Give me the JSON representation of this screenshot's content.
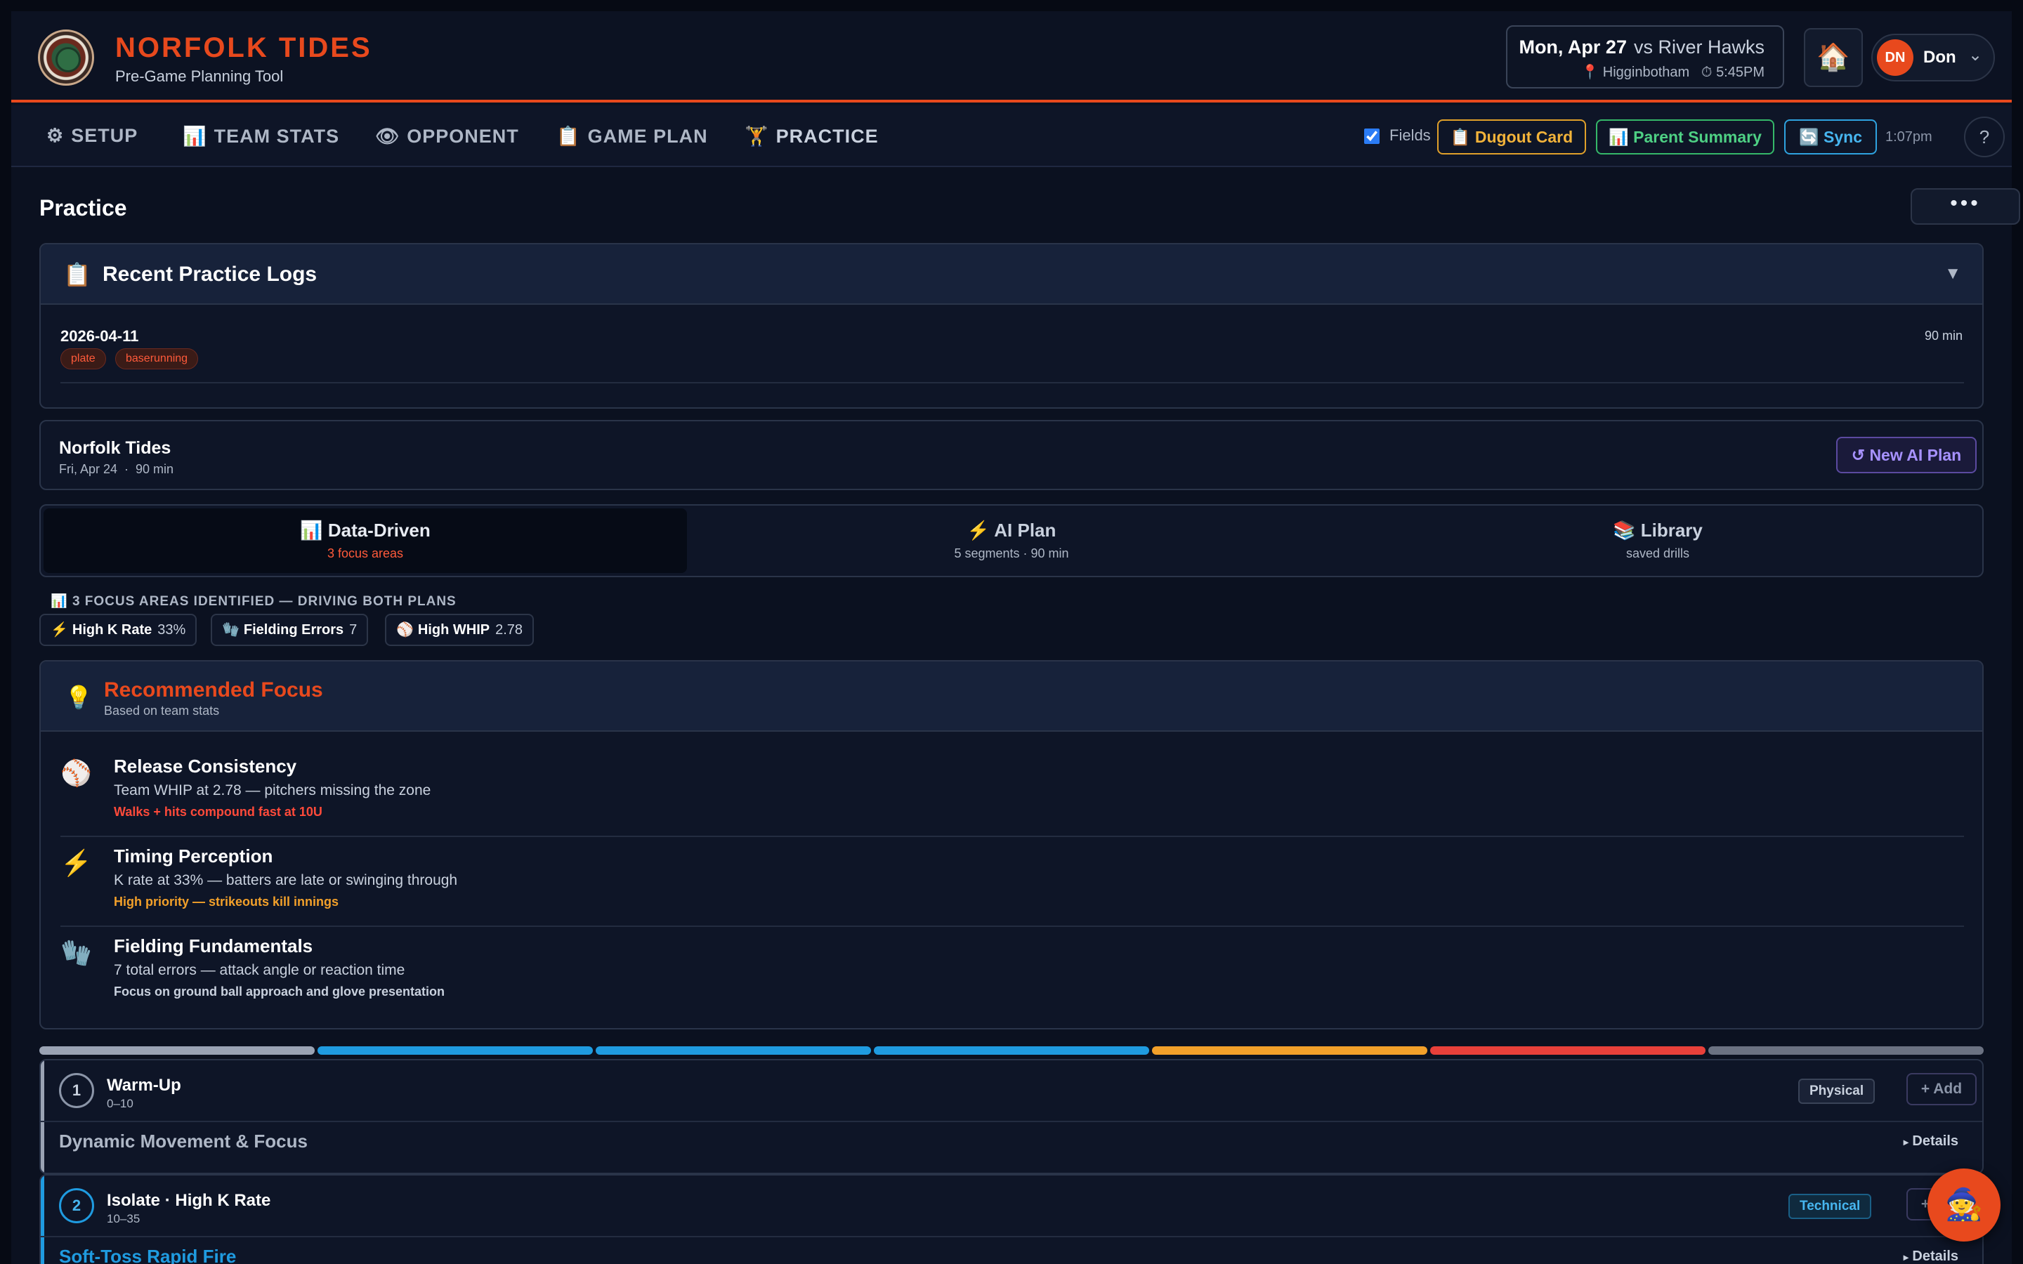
{
  "header": {
    "team_name": "NORFOLK TIDES",
    "subtitle": "Pre-Game Planning Tool",
    "game": {
      "date": "Mon, Apr 27",
      "opponent": "vs River Hawks",
      "location": "Higginbotham",
      "time": "5:45PM"
    },
    "user": {
      "initials": "DN",
      "name": "Don"
    }
  },
  "nav": {
    "items": [
      {
        "label": "SETUP",
        "icon": "⚙"
      },
      {
        "label": "TEAM STATS",
        "icon": "📊"
      },
      {
        "label": "OPPONENT",
        "icon": "👁"
      },
      {
        "label": "GAME PLAN",
        "icon": "📋"
      },
      {
        "label": "PRACTICE",
        "icon": "🏋"
      }
    ],
    "fields_label": "Fields",
    "dugout_card": "Dugout Card",
    "parent_summary": "Parent Summary",
    "sync": "Sync",
    "sync_time": "1:07pm",
    "help": "?"
  },
  "page": {
    "title": "Practice",
    "more": "•••"
  },
  "logs": {
    "title": "Recent Practice Logs",
    "entries": [
      {
        "date": "2026-04-11",
        "duration": "90 min",
        "tags": [
          "plate",
          "baserunning"
        ]
      }
    ]
  },
  "plan": {
    "team": "Norfolk Tides",
    "date": "Fri, Apr 24",
    "duration": "90 min",
    "new_ai_plan": "New AI Plan"
  },
  "tabs": [
    {
      "label": "Data-Driven",
      "sub": "3 focus areas",
      "icon": "📊"
    },
    {
      "label": "AI Plan",
      "sub": "5 segments · 90 min",
      "icon": "⚡"
    },
    {
      "label": "Library",
      "sub": "saved drills",
      "icon": "📚"
    }
  ],
  "focus": {
    "label": "3 FOCUS AREAS IDENTIFIED — DRIVING BOTH PLANS",
    "chips": [
      {
        "label": "High K Rate",
        "value": "33%"
      },
      {
        "label": "Fielding Errors",
        "value": "7"
      },
      {
        "label": "High WHIP",
        "value": "2.78"
      }
    ]
  },
  "recommended": {
    "title": "Recommended Focus",
    "subtitle": "Based on team stats",
    "items": [
      {
        "title": "Release Consistency",
        "desc": "Team WHIP at 2.78 — pitchers missing the zone",
        "note": "Walks + hits compound fast at 10U",
        "note_color": "#ff4a3a"
      },
      {
        "title": "Timing Perception",
        "desc": "K rate at 33% — batters are late or swinging through",
        "note": "High priority — strikeouts kill innings",
        "note_color": "#f2a02a"
      },
      {
        "title": "Fielding Fundamentals",
        "desc": "7 total errors — attack angle or reaction time",
        "note": "Focus on ground ball approach and glove presentation",
        "note_color": "#c9d1de"
      }
    ]
  },
  "segment_colors": [
    "#9aa3b4",
    "#1f9be0",
    "#1f9be0",
    "#1f9be0",
    "#f2a02a",
    "#e8403a",
    "#6b7282"
  ],
  "segments": [
    {
      "num": "1",
      "title": "Warm-Up",
      "time": "0–10",
      "badge": "Physical",
      "add": "+ Add",
      "drill": "Dynamic Movement & Focus",
      "details": "Details"
    },
    {
      "num": "2",
      "title": "Isolate · High K Rate",
      "time": "10–35",
      "badge": "Technical",
      "add": "+ Add",
      "drill": "Soft-Toss Rapid Fire",
      "details": "Details"
    }
  ]
}
